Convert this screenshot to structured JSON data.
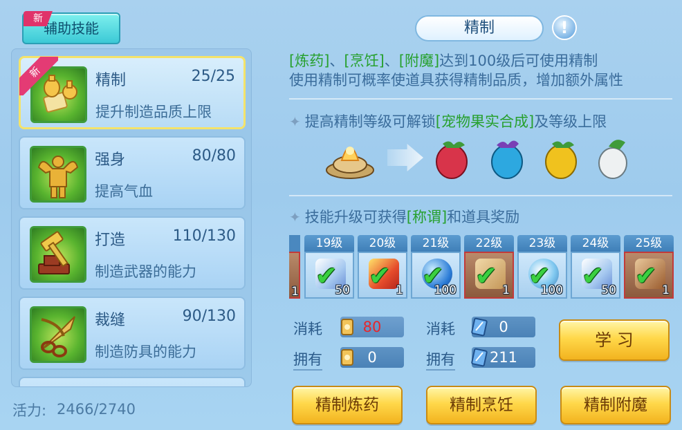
{
  "header": {
    "tab_label": "辅助技能",
    "tab_new_badge": "新"
  },
  "skills": [
    {
      "name": "精制",
      "level": "25/25",
      "desc": "提升制造品质上限",
      "badge": "新",
      "selected": true
    },
    {
      "name": "强身",
      "level": "80/80",
      "desc": "提高气血"
    },
    {
      "name": "打造",
      "level": "110/130",
      "desc": "制造武器的能力"
    },
    {
      "name": "裁缝",
      "level": "90/130",
      "desc": "制造防具的能力"
    }
  ],
  "vitality": {
    "label": "活力:",
    "value": "2466/2740"
  },
  "detail": {
    "title": "精制",
    "info_icon": "!",
    "desc1": {
      "g1": "[炼药]",
      "s1": "、",
      "g2": "[烹饪]",
      "s2": "、",
      "g3": "[附魔]",
      "rest": "达到100级后可使用精制"
    },
    "desc2": "使用精制可概率使道具获得精制品质，增加额外属性",
    "unlock_head": {
      "pre": "提高精制等级可解锁",
      "green": "[宠物果实合成]",
      "post": "及等级上限"
    },
    "reward_head": {
      "pre": "技能升级可获得",
      "green": "[称谓]",
      "post": "和道具奖励"
    }
  },
  "unlock_items": [
    {
      "icon": "alchemy-furnace-icon"
    },
    {
      "icon": "red-pet-fruit-icon",
      "color": "#d8344a"
    },
    {
      "icon": "blue-pet-fruit-icon",
      "color": "#2da8e0"
    },
    {
      "icon": "yellow-pet-fruit-icon",
      "color": "#f0c21e"
    },
    {
      "icon": "white-pet-fruit-icon",
      "color": "#eef1f2"
    }
  ],
  "rewards": [
    {
      "level": "19级",
      "count": "50",
      "icon": "crystal-icon",
      "border": "blue"
    },
    {
      "level": "20级",
      "count": "1",
      "icon": "gift-box-icon",
      "border": "blue"
    },
    {
      "level": "21级",
      "count": "100",
      "icon": "blue-orb-icon",
      "border": "blue"
    },
    {
      "level": "22级",
      "count": "1",
      "icon": "scroll-icon",
      "border": "red"
    },
    {
      "level": "23级",
      "count": "100",
      "icon": "ring-orb-icon",
      "border": "blue"
    },
    {
      "level": "24级",
      "count": "50",
      "icon": "crystal-icon",
      "border": "blue"
    },
    {
      "level": "25级",
      "count": "1",
      "icon": "book-icon",
      "border": "red"
    }
  ],
  "partial_reward": {
    "count": "1"
  },
  "costs": {
    "consume_label": "消耗",
    "own_label": "拥有",
    "vitality_consume": "80",
    "vitality_own": "0",
    "crystal_consume": "0",
    "crystal_own": "211"
  },
  "buttons": {
    "learn": "学 习",
    "refine_alchemy": "精制炼药",
    "refine_cooking": "精制烹饪",
    "refine_enchant": "精制附魔"
  },
  "colors": {
    "green_text": "#27a02e",
    "red_value": "#e8262b",
    "gold_button": "#ffd84a"
  }
}
